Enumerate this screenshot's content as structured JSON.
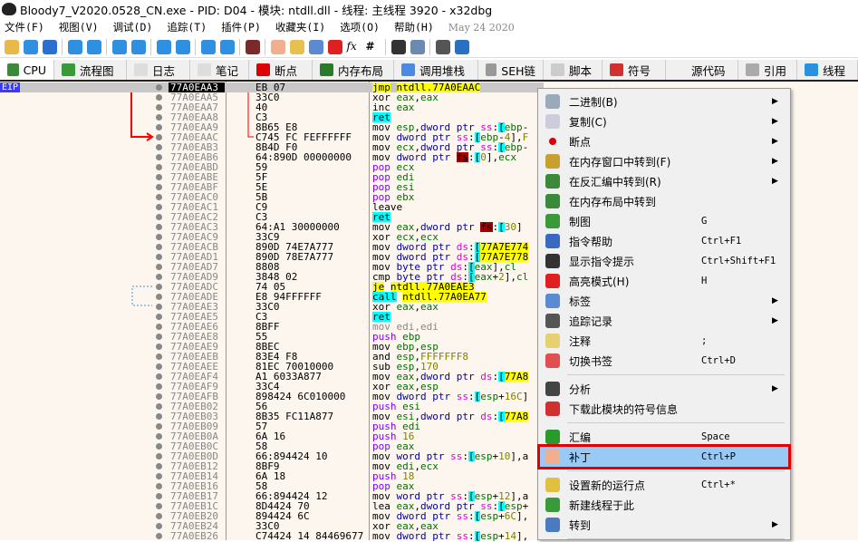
{
  "window": {
    "title": "Bloody7_V2020.0528_CN.exe - PID: D04 - 模块: ntdll.dll - 线程: 主线程 3920 - x32dbg"
  },
  "menubar": {
    "items": [
      "文件(F)",
      "视图(V)",
      "调试(D)",
      "追踪(T)",
      "插件(P)",
      "收藏夹(I)",
      "选项(O)",
      "帮助(H)"
    ],
    "date": "May 24 2020"
  },
  "toolbar": {
    "icons": [
      "open-icon",
      "restart-icon",
      "stop-icon",
      "run-icon",
      "pause-icon",
      "step-into-icon",
      "step-over-icon",
      "trace-into-icon",
      "trace-over-icon",
      "execute-till-return-icon",
      "run-to-user-code-icon",
      "scylla-icon",
      "patch-icon",
      "comment-icon",
      "label-icon",
      "bookmark-icon",
      "function-icon",
      "hash-icon",
      "font-icon",
      "device-icon",
      "calculator-icon",
      "globe-icon"
    ],
    "icon_colors": [
      "#e8b84a",
      "#2f8fe0",
      "#2a70d0",
      "#2f8fe0",
      "#2f8fe0",
      "#2f8fe0",
      "#2f8fe0",
      "#2f8fe0",
      "#2f8fe0",
      "#2f8fe0",
      "#2f8fe0",
      "#7a2a2a",
      "#f0b090",
      "#e8c050",
      "#5a8ad0",
      "#e02020",
      "#555",
      "#333",
      "#333",
      "#6a8ab0",
      "#555",
      "#2a70c0"
    ],
    "fx": "fx",
    "hash": "#"
  },
  "tabs": [
    {
      "label": "CPU",
      "color": "#3a8a3a"
    },
    {
      "label": "流程图",
      "color": "#3a9a3a"
    },
    {
      "label": "日志",
      "color": "#ddd"
    },
    {
      "label": "笔记",
      "color": "#ddd"
    },
    {
      "label": "断点",
      "color": "#d00"
    },
    {
      "label": "内存布局",
      "color": "#2a7a2a"
    },
    {
      "label": "调用堆栈",
      "color": "#4a8ae0"
    },
    {
      "label": "SEH链",
      "color": "#999"
    },
    {
      "label": "脚本",
      "color": "#ccc"
    },
    {
      "label": "符号",
      "color": "#d03030"
    },
    {
      "label": "源代码",
      "color": "transparent"
    },
    {
      "label": "引用",
      "color": "#aaa"
    },
    {
      "label": "线程",
      "color": "#2a90e0"
    }
  ],
  "eip_label": "EIP",
  "disasm": [
    [
      "77A0EAA3",
      "EB 07",
      "jmp ntdll.77A0EAAC"
    ],
    [
      "77A0EAA5",
      "33C0",
      "xor eax,eax"
    ],
    [
      "77A0EAA7",
      "40",
      "inc eax"
    ],
    [
      "77A0EAA8",
      "C3",
      "ret"
    ],
    [
      "77A0EAA9",
      "8B65 E8",
      "mov esp,dword ptr ss:[ebp-"
    ],
    [
      "77A0EAAC",
      "C745 FC FEFFFFFF",
      "mov dword ptr ss:[ebp-4],F"
    ],
    [
      "77A0EAB3",
      "8B4D F0",
      "mov ecx,dword ptr ss:[ebp-"
    ],
    [
      "77A0EAB6",
      "64:890D 00000000",
      "mov dword ptr fs:[0],ecx"
    ],
    [
      "77A0EABD",
      "59",
      "pop ecx"
    ],
    [
      "77A0EABE",
      "5F",
      "pop edi"
    ],
    [
      "77A0EABF",
      "5E",
      "pop esi"
    ],
    [
      "77A0EAC0",
      "5B",
      "pop ebx"
    ],
    [
      "77A0EAC1",
      "C9",
      "leave"
    ],
    [
      "77A0EAC2",
      "C3",
      "ret"
    ],
    [
      "77A0EAC3",
      "64:A1 30000000",
      "mov eax,dword ptr fs:[30]"
    ],
    [
      "77A0EAC9",
      "33C9",
      "xor ecx,ecx"
    ],
    [
      "77A0EACB",
      "890D 74E7A777",
      "mov dword ptr ds:[77A7E774"
    ],
    [
      "77A0EAD1",
      "890D 78E7A777",
      "mov dword ptr ds:[77A7E778"
    ],
    [
      "77A0EAD7",
      "8808",
      "mov byte ptr ds:[eax],cl"
    ],
    [
      "77A0EAD9",
      "3848 02",
      "cmp byte ptr ds:[eax+2],cl"
    ],
    [
      "77A0EADC",
      "74 05",
      "je ntdll.77A0EAE3"
    ],
    [
      "77A0EADE",
      "E8 94FFFFFF",
      "call ntdll.77A0EA77"
    ],
    [
      "77A0EAE3",
      "33C0",
      "xor eax,eax"
    ],
    [
      "77A0EAE5",
      "C3",
      "ret"
    ],
    [
      "77A0EAE6",
      "8BFF",
      "mov edi,edi"
    ],
    [
      "77A0EAE8",
      "55",
      "push ebp"
    ],
    [
      "77A0EAE9",
      "8BEC",
      "mov ebp,esp"
    ],
    [
      "77A0EAEB",
      "83E4 F8",
      "and esp,FFFFFFF8"
    ],
    [
      "77A0EAEE",
      "81EC 70010000",
      "sub esp,170"
    ],
    [
      "77A0EAF4",
      "A1 6033A877",
      "mov eax,dword ptr ds:[77A8"
    ],
    [
      "77A0EAF9",
      "33C4",
      "xor eax,esp"
    ],
    [
      "77A0EAFB",
      "898424 6C010000",
      "mov dword ptr ss:[esp+16C]"
    ],
    [
      "77A0EB02",
      "56",
      "push esi"
    ],
    [
      "77A0EB03",
      "8B35 FC11A877",
      "mov esi,dword ptr ds:[77A8"
    ],
    [
      "77A0EB09",
      "57",
      "push edi"
    ],
    [
      "77A0EB0A",
      "6A 16",
      "push 16"
    ],
    [
      "77A0EB0C",
      "58",
      "pop eax"
    ],
    [
      "77A0EB0D",
      "66:894424 10",
      "mov word ptr ss:[esp+10],a"
    ],
    [
      "77A0EB12",
      "8BF9",
      "mov edi,ecx"
    ],
    [
      "77A0EB14",
      "6A 18",
      "push 18"
    ],
    [
      "77A0EB16",
      "58",
      "pop eax"
    ],
    [
      "77A0EB17",
      "66:894424 12",
      "mov word ptr ss:[esp+12],a"
    ],
    [
      "77A0EB1C",
      "8D4424 70",
      "lea eax,dword ptr ss:[esp+"
    ],
    [
      "77A0EB20",
      "894424 6C",
      "mov dword ptr ss:[esp+6C],"
    ],
    [
      "77A0EB24",
      "33C0",
      "xor eax,eax"
    ],
    [
      "77A0EB26",
      "C74424 14 84469677",
      "mov dword ptr ss:[esp+14],"
    ]
  ],
  "context_menu": [
    {
      "label": "二进制(B)",
      "shortcut": "",
      "submenu": true,
      "icon": "binary-icon",
      "color": "#9ab"
    },
    {
      "label": "复制(C)",
      "shortcut": "",
      "submenu": true,
      "icon": "copy-icon",
      "color": "#ccd"
    },
    {
      "label": "断点",
      "shortcut": "",
      "submenu": true,
      "icon": "breakpoint-icon",
      "color": "#d00"
    },
    {
      "label": "在内存窗口中转到(F)",
      "shortcut": "",
      "submenu": true,
      "icon": "memory-truck-icon",
      "color": "#c9a030"
    },
    {
      "label": "在反汇编中转到(R)",
      "shortcut": "",
      "submenu": true,
      "icon": "cpu-chip-icon",
      "color": "#3a8a3a"
    },
    {
      "label": "在内存布局中转到",
      "shortcut": "",
      "submenu": false,
      "icon": "memory-map-icon",
      "color": "#3a8a3a"
    },
    {
      "label": "制图",
      "shortcut": "G",
      "submenu": false,
      "icon": "tree-icon",
      "color": "#3a9a3a"
    },
    {
      "label": "指令帮助",
      "shortcut": "Ctrl+F1",
      "submenu": false,
      "icon": "help-book-icon",
      "color": "#3a6ac0"
    },
    {
      "label": "显示指令提示",
      "shortcut": "Ctrl+Shift+F1",
      "submenu": false,
      "icon": "penguin-icon",
      "color": "#333"
    },
    {
      "label": "高亮模式(H)",
      "shortcut": "H",
      "submenu": false,
      "icon": "highlighter-icon",
      "color": "#e02020"
    },
    {
      "label": "标签",
      "shortcut": "",
      "submenu": true,
      "icon": "label-icon",
      "color": "#5a8ad0"
    },
    {
      "label": "追踪记录",
      "shortcut": "",
      "submenu": true,
      "icon": "footprints-icon",
      "color": "#555"
    },
    {
      "label": "注释",
      "shortcut": ";",
      "submenu": false,
      "icon": "comment-icon",
      "color": "#e8d070"
    },
    {
      "label": "切换书签",
      "shortcut": "Ctrl+D",
      "submenu": false,
      "icon": "bookmark-icon",
      "color": "#e05050"
    },
    {
      "label": "分析",
      "shortcut": "",
      "submenu": true,
      "icon": "magic-wand-icon",
      "color": "#444"
    },
    {
      "label": "下载此模块的符号信息",
      "shortcut": "",
      "submenu": false,
      "icon": "symbols-icon",
      "color": "#d03030"
    },
    {
      "label": "汇编",
      "shortcut": "Space",
      "submenu": false,
      "icon": "assemble-icon",
      "color": "#2a9a2a"
    },
    {
      "label": "补丁",
      "shortcut": "Ctrl+P",
      "submenu": false,
      "icon": "patch-bandage-icon",
      "color": "#f0b090",
      "highlighted": true
    },
    {
      "label": "设置新的运行点",
      "shortcut": "Ctrl+*",
      "submenu": false,
      "icon": "origin-icon",
      "color": "#e0c040"
    },
    {
      "label": "新建线程于此",
      "shortcut": "",
      "submenu": false,
      "icon": "new-thread-icon",
      "color": "#3a9a3a"
    },
    {
      "label": "转到",
      "shortcut": "",
      "submenu": true,
      "icon": "goto-car-icon",
      "color": "#4a7ac0"
    }
  ],
  "colors": {
    "selection": "#99c9f5",
    "highlight_box": "#e00000",
    "eip": "#3b3bff",
    "jump_arrow": "#ff0000",
    "background": "#fdf6ee"
  }
}
